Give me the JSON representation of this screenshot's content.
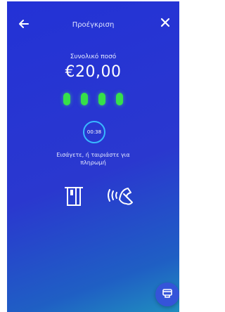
{
  "header": {
    "title": "Προέγκριση",
    "back_icon": "arrow-left-icon",
    "close_icon": "close-icon"
  },
  "payment": {
    "amount_label": "Συνολικό ποσό",
    "amount": "€20,00",
    "pin_digits_entered": 4,
    "timer": "00:38",
    "instruction": "Εισάγετε, ή ταιριάστε για πληρωμή"
  },
  "methods": {
    "insert_icon": "card-insert-icon",
    "contactless_icon": "contactless-tap-icon"
  },
  "fab": {
    "icon": "card-reader-icon"
  },
  "colors": {
    "background_top": "#2332d6",
    "background_bottom": "#1f8fbf",
    "pin_dot": "#36e04a",
    "timer_ring": "#39b8ff",
    "fab": "#3554d9"
  }
}
